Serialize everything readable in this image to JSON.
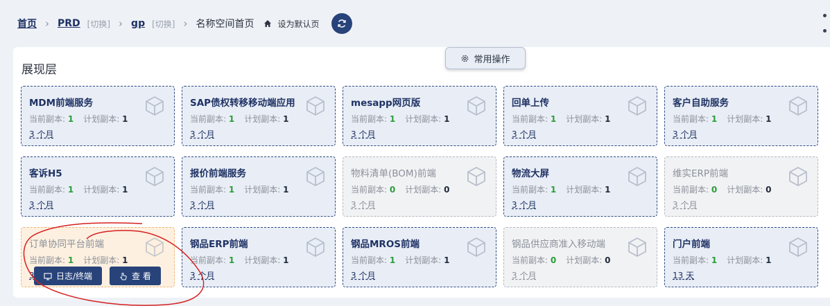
{
  "breadcrumb": {
    "home": "首页",
    "env": "PRD",
    "env_switch": "[切换]",
    "project": "gp",
    "project_switch": "[切换]",
    "current": "名称空间首页",
    "set_default": "设为默认页"
  },
  "panel": {
    "title": "展现层",
    "common_ops": "常用操作"
  },
  "labels": {
    "current_replicas": "当前副本:",
    "planned_replicas": "计划副本:"
  },
  "cards": [
    {
      "name": "MDM前端服务",
      "current": "1",
      "planned": "1",
      "age": "3 个月",
      "state": "normal"
    },
    {
      "name": "SAP债权转移移动端应用",
      "current": "1",
      "planned": "1",
      "age": "3 个月",
      "state": "normal"
    },
    {
      "name": "mesapp网页版",
      "current": "1",
      "planned": "1",
      "age": "3 个月",
      "state": "normal"
    },
    {
      "name": "回单上传",
      "current": "1",
      "planned": "1",
      "age": "3 个月",
      "state": "normal"
    },
    {
      "name": "客户自助服务",
      "current": "1",
      "planned": "1",
      "age": "3 个月",
      "state": "normal"
    },
    {
      "name": "客诉H5",
      "current": "1",
      "planned": "1",
      "age": "3 个月",
      "state": "normal"
    },
    {
      "name": "报价前端服务",
      "current": "1",
      "planned": "1",
      "age": "3 个月",
      "state": "normal"
    },
    {
      "name": "物料清单(BOM)前端",
      "current": "0",
      "planned": "0",
      "age": "3 个月",
      "state": "inactive"
    },
    {
      "name": "物流大屏",
      "current": "1",
      "planned": "1",
      "age": "3 个月",
      "state": "normal"
    },
    {
      "name": "维实ERP前端",
      "current": "0",
      "planned": "0",
      "age": "3 个月",
      "state": "inactive"
    },
    {
      "name": "订单协同平台前端",
      "current": "1",
      "planned": "1",
      "age": "3 个月",
      "state": "active"
    },
    {
      "name": "钢品ERP前端",
      "current": "1",
      "planned": "1",
      "age": "3 个月",
      "state": "normal"
    },
    {
      "name": "钢品MROS前端",
      "current": "1",
      "planned": "1",
      "age": "3 个月",
      "state": "normal"
    },
    {
      "name": "钢品供应商准入移动端",
      "current": "0",
      "planned": "0",
      "age": "3 个月",
      "state": "inactive"
    },
    {
      "name": "门户前端",
      "current": "1",
      "planned": "1",
      "age": "13 天",
      "state": "normal"
    }
  ],
  "card_actions": {
    "logs": "日志/终端",
    "view": "查 看"
  },
  "colors": {
    "primary": "#28437a",
    "running": "#2a9d3a",
    "card_bg": "#e9eef6",
    "active_bg": "#fdf0e0"
  },
  "icons": [
    "home-icon",
    "refresh-icon",
    "cog-icon",
    "cube-icon",
    "monitor-icon",
    "hand-icon"
  ]
}
